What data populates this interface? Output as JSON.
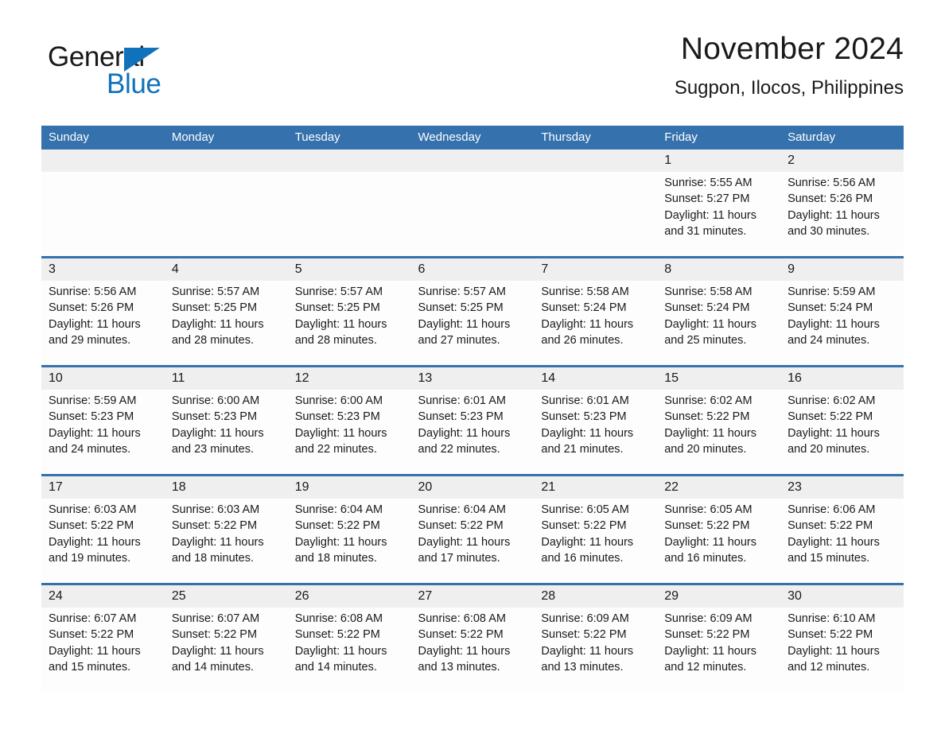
{
  "logo": {
    "word_dark": "General",
    "word_blue": "Blue",
    "triangle_color": "#1072bb"
  },
  "header": {
    "title": "November 2024",
    "subtitle": "Sugpon, Ilocos, Philippines"
  },
  "colors": {
    "header_blue": "#3571ac",
    "row_divider_blue": "#3571ac",
    "daynum_band": "#efefef",
    "text": "#1a1a1a",
    "cell_bg": "#fdfdfd"
  },
  "weekdays": [
    "Sunday",
    "Monday",
    "Tuesday",
    "Wednesday",
    "Thursday",
    "Friday",
    "Saturday"
  ],
  "labels": {
    "sunrise_prefix": "Sunrise:",
    "sunset_prefix": "Sunset:",
    "daylight_prefix": "Daylight:"
  },
  "weeks": [
    {
      "days": [
        {
          "num": "",
          "sunrise": "",
          "sunset": "",
          "daylight_line1": "",
          "daylight_line2": ""
        },
        {
          "num": "",
          "sunrise": "",
          "sunset": "",
          "daylight_line1": "",
          "daylight_line2": ""
        },
        {
          "num": "",
          "sunrise": "",
          "sunset": "",
          "daylight_line1": "",
          "daylight_line2": ""
        },
        {
          "num": "",
          "sunrise": "",
          "sunset": "",
          "daylight_line1": "",
          "daylight_line2": ""
        },
        {
          "num": "",
          "sunrise": "",
          "sunset": "",
          "daylight_line1": "",
          "daylight_line2": ""
        },
        {
          "num": "1",
          "sunrise": "Sunrise: 5:55 AM",
          "sunset": "Sunset: 5:27 PM",
          "daylight_line1": "Daylight: 11 hours",
          "daylight_line2": "and 31 minutes."
        },
        {
          "num": "2",
          "sunrise": "Sunrise: 5:56 AM",
          "sunset": "Sunset: 5:26 PM",
          "daylight_line1": "Daylight: 11 hours",
          "daylight_line2": "and 30 minutes."
        }
      ]
    },
    {
      "days": [
        {
          "num": "3",
          "sunrise": "Sunrise: 5:56 AM",
          "sunset": "Sunset: 5:26 PM",
          "daylight_line1": "Daylight: 11 hours",
          "daylight_line2": "and 29 minutes."
        },
        {
          "num": "4",
          "sunrise": "Sunrise: 5:57 AM",
          "sunset": "Sunset: 5:25 PM",
          "daylight_line1": "Daylight: 11 hours",
          "daylight_line2": "and 28 minutes."
        },
        {
          "num": "5",
          "sunrise": "Sunrise: 5:57 AM",
          "sunset": "Sunset: 5:25 PM",
          "daylight_line1": "Daylight: 11 hours",
          "daylight_line2": "and 28 minutes."
        },
        {
          "num": "6",
          "sunrise": "Sunrise: 5:57 AM",
          "sunset": "Sunset: 5:25 PM",
          "daylight_line1": "Daylight: 11 hours",
          "daylight_line2": "and 27 minutes."
        },
        {
          "num": "7",
          "sunrise": "Sunrise: 5:58 AM",
          "sunset": "Sunset: 5:24 PM",
          "daylight_line1": "Daylight: 11 hours",
          "daylight_line2": "and 26 minutes."
        },
        {
          "num": "8",
          "sunrise": "Sunrise: 5:58 AM",
          "sunset": "Sunset: 5:24 PM",
          "daylight_line1": "Daylight: 11 hours",
          "daylight_line2": "and 25 minutes."
        },
        {
          "num": "9",
          "sunrise": "Sunrise: 5:59 AM",
          "sunset": "Sunset: 5:24 PM",
          "daylight_line1": "Daylight: 11 hours",
          "daylight_line2": "and 24 minutes."
        }
      ]
    },
    {
      "days": [
        {
          "num": "10",
          "sunrise": "Sunrise: 5:59 AM",
          "sunset": "Sunset: 5:23 PM",
          "daylight_line1": "Daylight: 11 hours",
          "daylight_line2": "and 24 minutes."
        },
        {
          "num": "11",
          "sunrise": "Sunrise: 6:00 AM",
          "sunset": "Sunset: 5:23 PM",
          "daylight_line1": "Daylight: 11 hours",
          "daylight_line2": "and 23 minutes."
        },
        {
          "num": "12",
          "sunrise": "Sunrise: 6:00 AM",
          "sunset": "Sunset: 5:23 PM",
          "daylight_line1": "Daylight: 11 hours",
          "daylight_line2": "and 22 minutes."
        },
        {
          "num": "13",
          "sunrise": "Sunrise: 6:01 AM",
          "sunset": "Sunset: 5:23 PM",
          "daylight_line1": "Daylight: 11 hours",
          "daylight_line2": "and 22 minutes."
        },
        {
          "num": "14",
          "sunrise": "Sunrise: 6:01 AM",
          "sunset": "Sunset: 5:23 PM",
          "daylight_line1": "Daylight: 11 hours",
          "daylight_line2": "and 21 minutes."
        },
        {
          "num": "15",
          "sunrise": "Sunrise: 6:02 AM",
          "sunset": "Sunset: 5:22 PM",
          "daylight_line1": "Daylight: 11 hours",
          "daylight_line2": "and 20 minutes."
        },
        {
          "num": "16",
          "sunrise": "Sunrise: 6:02 AM",
          "sunset": "Sunset: 5:22 PM",
          "daylight_line1": "Daylight: 11 hours",
          "daylight_line2": "and 20 minutes."
        }
      ]
    },
    {
      "days": [
        {
          "num": "17",
          "sunrise": "Sunrise: 6:03 AM",
          "sunset": "Sunset: 5:22 PM",
          "daylight_line1": "Daylight: 11 hours",
          "daylight_line2": "and 19 minutes."
        },
        {
          "num": "18",
          "sunrise": "Sunrise: 6:03 AM",
          "sunset": "Sunset: 5:22 PM",
          "daylight_line1": "Daylight: 11 hours",
          "daylight_line2": "and 18 minutes."
        },
        {
          "num": "19",
          "sunrise": "Sunrise: 6:04 AM",
          "sunset": "Sunset: 5:22 PM",
          "daylight_line1": "Daylight: 11 hours",
          "daylight_line2": "and 18 minutes."
        },
        {
          "num": "20",
          "sunrise": "Sunrise: 6:04 AM",
          "sunset": "Sunset: 5:22 PM",
          "daylight_line1": "Daylight: 11 hours",
          "daylight_line2": "and 17 minutes."
        },
        {
          "num": "21",
          "sunrise": "Sunrise: 6:05 AM",
          "sunset": "Sunset: 5:22 PM",
          "daylight_line1": "Daylight: 11 hours",
          "daylight_line2": "and 16 minutes."
        },
        {
          "num": "22",
          "sunrise": "Sunrise: 6:05 AM",
          "sunset": "Sunset: 5:22 PM",
          "daylight_line1": "Daylight: 11 hours",
          "daylight_line2": "and 16 minutes."
        },
        {
          "num": "23",
          "sunrise": "Sunrise: 6:06 AM",
          "sunset": "Sunset: 5:22 PM",
          "daylight_line1": "Daylight: 11 hours",
          "daylight_line2": "and 15 minutes."
        }
      ]
    },
    {
      "days": [
        {
          "num": "24",
          "sunrise": "Sunrise: 6:07 AM",
          "sunset": "Sunset: 5:22 PM",
          "daylight_line1": "Daylight: 11 hours",
          "daylight_line2": "and 15 minutes."
        },
        {
          "num": "25",
          "sunrise": "Sunrise: 6:07 AM",
          "sunset": "Sunset: 5:22 PM",
          "daylight_line1": "Daylight: 11 hours",
          "daylight_line2": "and 14 minutes."
        },
        {
          "num": "26",
          "sunrise": "Sunrise: 6:08 AM",
          "sunset": "Sunset: 5:22 PM",
          "daylight_line1": "Daylight: 11 hours",
          "daylight_line2": "and 14 minutes."
        },
        {
          "num": "27",
          "sunrise": "Sunrise: 6:08 AM",
          "sunset": "Sunset: 5:22 PM",
          "daylight_line1": "Daylight: 11 hours",
          "daylight_line2": "and 13 minutes."
        },
        {
          "num": "28",
          "sunrise": "Sunrise: 6:09 AM",
          "sunset": "Sunset: 5:22 PM",
          "daylight_line1": "Daylight: 11 hours",
          "daylight_line2": "and 13 minutes."
        },
        {
          "num": "29",
          "sunrise": "Sunrise: 6:09 AM",
          "sunset": "Sunset: 5:22 PM",
          "daylight_line1": "Daylight: 11 hours",
          "daylight_line2": "and 12 minutes."
        },
        {
          "num": "30",
          "sunrise": "Sunrise: 6:10 AM",
          "sunset": "Sunset: 5:22 PM",
          "daylight_line1": "Daylight: 11 hours",
          "daylight_line2": "and 12 minutes."
        }
      ]
    }
  ]
}
